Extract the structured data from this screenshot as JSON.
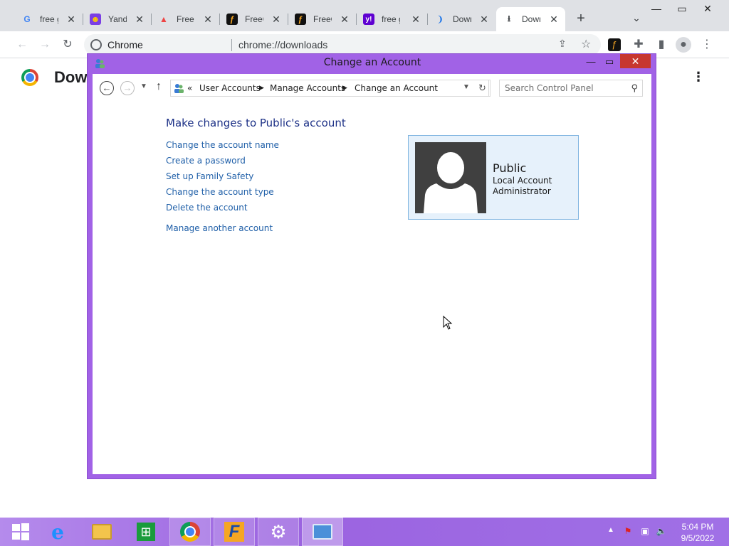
{
  "browser": {
    "tabs": [
      {
        "title": "free g",
        "favicon": "google-icon"
      },
      {
        "title": "Yande",
        "favicon": "yandex-icon"
      },
      {
        "title": "Free G",
        "favicon": "game-icon"
      },
      {
        "title": "FreeG",
        "favicon": "freeg-icon"
      },
      {
        "title": "FreeG",
        "favicon": "freeg-icon"
      },
      {
        "title": "free g",
        "favicon": "yahoo-icon"
      },
      {
        "title": "Down",
        "favicon": "loading-icon"
      },
      {
        "title": "Down",
        "favicon": "download-icon"
      }
    ],
    "omnibox": {
      "site_label": "Chrome",
      "url": "chrome://downloads"
    },
    "page_title": "Downloads"
  },
  "window": {
    "title": "Change an Account",
    "breadcrumb": {
      "overflow": "«",
      "items": [
        "User Accounts",
        "Manage Accounts",
        "Change an Account"
      ]
    },
    "search_placeholder": "Search Control Panel",
    "heading": "Make changes to Public's account",
    "links": [
      "Change the account name",
      "Create a password",
      "Set up Family Safety",
      "Change the account type",
      "Delete the account"
    ],
    "secondary_link": "Manage another account",
    "account": {
      "name": "Public",
      "type": "Local Account",
      "role": "Administrator"
    }
  },
  "taskbar": {
    "apps": [
      "internet-explorer-icon",
      "file-explorer-icon",
      "store-icon",
      "chrome-icon",
      "freeg-icon",
      "settings-icon",
      "control-panel-icon"
    ],
    "clock_time": "5:04 PM",
    "clock_date": "9/5/2022"
  },
  "colors": {
    "accent": "#a162e6",
    "link": "#1f5fa8",
    "heading": "#1e3287",
    "close": "#c7372f"
  }
}
